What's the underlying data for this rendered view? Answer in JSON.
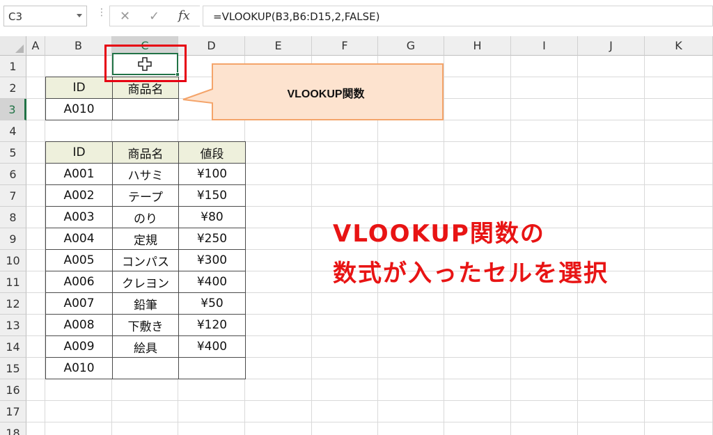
{
  "formula_bar": {
    "name_box": "C3",
    "formula": "=VLOOKUP(B3,B6:D15,2,FALSE)",
    "cancel_glyph": "✕",
    "enter_glyph": "✓",
    "fx_glyph": "fx"
  },
  "grid": {
    "columns": [
      "A",
      "B",
      "C",
      "D",
      "E",
      "F",
      "G",
      "H",
      "I",
      "J",
      "K"
    ],
    "selected_column": "C",
    "rows": [
      "1",
      "2",
      "3",
      "4",
      "5",
      "6",
      "7",
      "8",
      "9",
      "10",
      "11",
      "12",
      "13",
      "14",
      "15",
      "16",
      "17",
      "18"
    ],
    "selected_row": "3",
    "selected_cell": "C3"
  },
  "lookup_table": {
    "headers": [
      "ID",
      "商品名"
    ],
    "id_value": "A010",
    "name_value": ""
  },
  "data_table": {
    "headers": [
      "ID",
      "商品名",
      "値段"
    ],
    "rows": [
      [
        "A001",
        "ハサミ",
        "¥100"
      ],
      [
        "A002",
        "テープ",
        "¥150"
      ],
      [
        "A003",
        "のり",
        "¥80"
      ],
      [
        "A004",
        "定規",
        "¥250"
      ],
      [
        "A005",
        "コンパス",
        "¥300"
      ],
      [
        "A006",
        "クレヨン",
        "¥400"
      ],
      [
        "A007",
        "鉛筆",
        "¥50"
      ],
      [
        "A008",
        "下敷き",
        "¥120"
      ],
      [
        "A009",
        "絵具",
        "¥400"
      ],
      [
        "A010",
        "",
        ""
      ]
    ]
  },
  "callout": {
    "label": "VLOOKUP関数"
  },
  "annotation": {
    "line1": "VLOOKUP関数の",
    "line2": "数式が入ったセルを選択"
  },
  "colors": {
    "excel_green": "#217346",
    "highlight_red": "#e60012",
    "annotation_red": "#e81414",
    "callout_fill": "#fde3cf",
    "callout_border": "#f4a46a",
    "header_fill": "#eef0dc"
  }
}
